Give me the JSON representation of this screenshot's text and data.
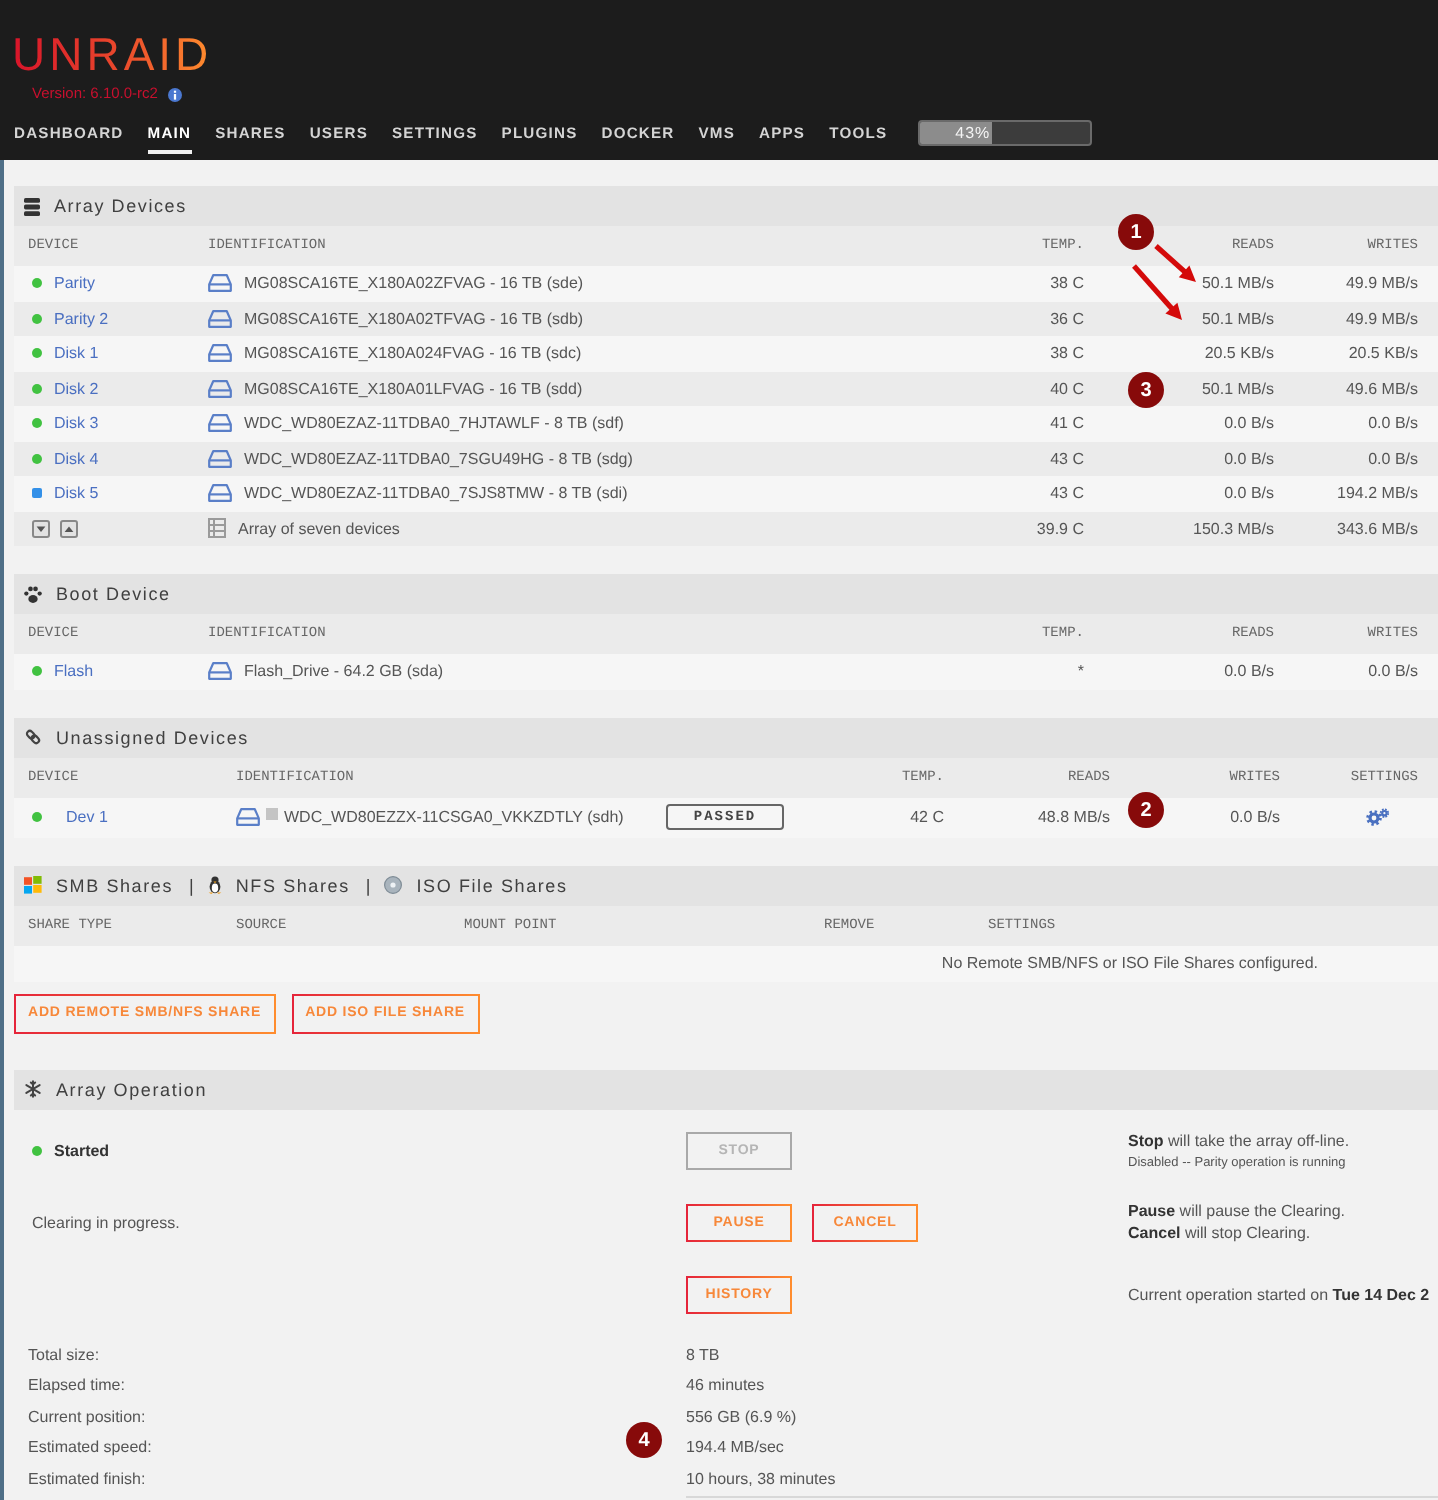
{
  "header": {
    "logo": "UNRAID",
    "version": "Version: 6.10.0-rc2",
    "nav": [
      {
        "label": "DASHBOARD",
        "selected": false
      },
      {
        "label": "MAIN",
        "selected": true
      },
      {
        "label": "SHARES",
        "selected": false
      },
      {
        "label": "USERS",
        "selected": false
      },
      {
        "label": "SETTINGS",
        "selected": false
      },
      {
        "label": "PLUGINS",
        "selected": false
      },
      {
        "label": "DOCKER",
        "selected": false
      },
      {
        "label": "VMS",
        "selected": false
      },
      {
        "label": "APPS",
        "selected": false
      },
      {
        "label": "TOOLS",
        "selected": false
      }
    ],
    "progress": {
      "level": 0.43,
      "reading": "43%"
    }
  },
  "array_devices": {
    "title": "Array Devices",
    "columns": [
      "DEVICE",
      "IDENTIFICATION",
      "TEMP.",
      "READS",
      "WRITES"
    ],
    "rows": [
      {
        "device": "Parity",
        "status": {
          "kind": "circle",
          "color": "#41c241"
        },
        "identification": "MG08SCA16TE_X180A02ZFVAG - 16 TB (sde)",
        "temp": "38 C",
        "reads": "50.1 MB/s",
        "writes": "49.9 MB/s"
      },
      {
        "device": "Parity 2",
        "status": {
          "kind": "circle",
          "color": "#41c241"
        },
        "identification": "MG08SCA16TE_X180A02TFVAG - 16 TB (sdb)",
        "temp": "36 C",
        "reads": "50.1 MB/s",
        "writes": "49.9 MB/s"
      },
      {
        "device": "Disk 1",
        "status": {
          "kind": "circle",
          "color": "#41c241"
        },
        "identification": "MG08SCA16TE_X180A024FVAG - 16 TB (sdc)",
        "temp": "38 C",
        "reads": "20.5 KB/s",
        "writes": "20.5 KB/s"
      },
      {
        "device": "Disk 2",
        "status": {
          "kind": "circle",
          "color": "#41c241"
        },
        "identification": "MG08SCA16TE_X180A01LFVAG - 16 TB (sdd)",
        "temp": "40 C",
        "reads": "50.1 MB/s",
        "writes": "49.6 MB/s"
      },
      {
        "device": "Disk 3",
        "status": {
          "kind": "circle",
          "color": "#41c241"
        },
        "identification": "WDC_WD80EZAZ-11TDBA0_7HJTAWLF - 8 TB (sdf)",
        "temp": "41 C",
        "reads": "0.0 B/s",
        "writes": "0.0 B/s"
      },
      {
        "device": "Disk 4",
        "status": {
          "kind": "circle",
          "color": "#41c241"
        },
        "identification": "WDC_WD80EZAZ-11TDBA0_7SGU49HG - 8 TB (sdg)",
        "temp": "43 C",
        "reads": "0.0 B/s",
        "writes": "0.0 B/s"
      },
      {
        "device": "Disk 5",
        "status": {
          "kind": "square",
          "color": "#3390e8"
        },
        "identification": "WDC_WD80EZAZ-11TDBA0_7SJS8TMW - 8 TB (sdi)",
        "temp": "43 C",
        "reads": "0.0 B/s",
        "writes": "194.2 MB/s"
      }
    ],
    "summary": {
      "identification": "Array of seven devices",
      "temp": "39.9 C",
      "reads": "150.3 MB/s",
      "writes": "343.6 MB/s"
    }
  },
  "boot_device": {
    "title": "Boot Device",
    "columns": [
      "DEVICE",
      "IDENTIFICATION",
      "TEMP.",
      "READS",
      "WRITES"
    ],
    "rows": [
      {
        "device": "Flash",
        "status": {
          "kind": "circle",
          "color": "#41c241"
        },
        "identification": "Flash_Drive - 64.2 GB (sda)",
        "temp": "*",
        "reads": "0.0 B/s",
        "writes": "0.0 B/s"
      }
    ]
  },
  "unassigned_devices": {
    "title": "Unassigned Devices",
    "columns": [
      "DEVICE",
      "IDENTIFICATION",
      "TEMP.",
      "READS",
      "WRITES",
      "SETTINGS"
    ],
    "rows": [
      {
        "device": "Dev 1",
        "status": {
          "kind": "circle",
          "color": "#41c241"
        },
        "identification": "WDC_WD80EZZX-11CSGA0_VKKZDTLY (sdh)",
        "smart": "PASSED",
        "temp": "42 C",
        "reads": "48.8 MB/s",
        "writes": "0.0 B/s"
      }
    ]
  },
  "remote_shares": {
    "title_parts": [
      {
        "label": "SMB Shares"
      },
      {
        "separator": "|",
        "label": "NFS Shares"
      },
      {
        "separator": "|",
        "label": "ISO File Shares"
      }
    ],
    "columns": [
      "SHARE TYPE",
      "SOURCE",
      "MOUNT POINT",
      "REMOVE",
      "SETTINGS"
    ],
    "empty_message": "No Remote SMB/NFS or ISO File Shares configured.",
    "buttons": [
      "ADD REMOTE SMB/NFS SHARE",
      "ADD ISO FILE SHARE"
    ]
  },
  "array_operation": {
    "title": "Array Operation",
    "rows": [
      {
        "kind": "status",
        "label": "Started",
        "color": "#41c241",
        "buttons": [
          {
            "label": "STOP",
            "disabled": true
          }
        ],
        "help": [
          {
            "kind": "line",
            "text": "**Stop** will take the array off-line."
          },
          {
            "kind": "note",
            "text": "Disabled -- Parity operation is running"
          }
        ]
      },
      {
        "kind": "text",
        "label": "Clearing in progress.",
        "buttons": [
          {
            "label": "PAUSE",
            "disabled": false
          },
          {
            "label": "CANCEL",
            "disabled": false
          }
        ],
        "help": [
          {
            "kind": "line",
            "text": "**Pause** will pause the Clearing."
          },
          {
            "kind": "line",
            "text": "**Cancel** will stop Clearing."
          }
        ]
      },
      {
        "buttons": [
          {
            "label": "HISTORY",
            "disabled": false
          }
        ],
        "help": [
          {
            "kind": "line",
            "text": "Current operation started on **Tue 14 Dec 2**"
          }
        ]
      }
    ],
    "details": [
      {
        "label": "Total size:",
        "value": "8 TB"
      },
      {
        "label": "Elapsed time:",
        "value": "46 minutes"
      },
      {
        "label": "Current position:",
        "value": "556 GB (6.9 %)"
      },
      {
        "label": "Estimated speed:",
        "value": "194.4 MB/sec"
      },
      {
        "label": "Estimated finish:",
        "value": "10 hours, 38 minutes"
      }
    ]
  },
  "annotations": [
    {
      "label": "1"
    },
    {
      "label": "3"
    },
    {
      "label": "2"
    },
    {
      "label": "4"
    }
  ]
}
